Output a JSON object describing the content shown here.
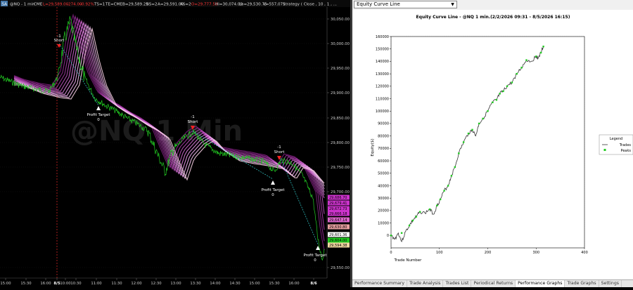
{
  "price_chart": {
    "header": {
      "badge": "SA",
      "symbol": "@NQ - 1 min",
      "exchange": "CME",
      "last": "L=29,589.00",
      "change": "-274.00",
      "change_pct": "-0.92%",
      "ts": "TS=1",
      "te": "TE=CME",
      "bid": "B=29,589.25",
      "bs": "BS=2",
      "ask": "A=29,591.00",
      "as": "AS=2",
      "open": "O=29,777.50",
      "high": "Hi=30,074.00",
      "low": "Lo=29,530.75",
      "volume": "V=557,071",
      "strategy": "Strategy ( Close , 10 , 1 , ..."
    },
    "watermark": "@NQ 1 Min",
    "y_ticks": [
      "30,050.00",
      "30,000.00",
      "29,950.00",
      "29,900.00",
      "29,850.00",
      "29,800.00",
      "29,750.00",
      "29,700.00",
      "29,550.00"
    ],
    "price_tags": [
      {
        "text": "29,686.70",
        "color": "#cc33cc"
      },
      {
        "text": "29,679.41",
        "color": "#cc33cc"
      },
      {
        "text": "29,672.73",
        "color": "#cc33cc"
      },
      {
        "text": "29,666.18",
        "color": "#cc33cc"
      },
      {
        "text": "29,647.14",
        "color": "#dd66cc"
      },
      {
        "text": "29,630.80",
        "color": "#e8a0a0"
      },
      {
        "text": "29,601.36",
        "color": "#ffffff"
      },
      {
        "text": "29,604.00",
        "color": "#22cc22"
      },
      {
        "text": "29,594.38",
        "color": "#f0d8a0"
      }
    ],
    "x_ticks": [
      "15:00",
      "15:30",
      "16:00",
      "8/5",
      "10:00",
      "10:30",
      "11:00",
      "11:30",
      "12:00",
      "12:30",
      "13:00",
      "13:30",
      "14:00",
      "14:30",
      "15:00",
      "15:30",
      "16:00",
      "8/6"
    ],
    "markers": [
      {
        "kind": "short",
        "label1": "-1",
        "label2": "Short"
      },
      {
        "kind": "short",
        "label1": "-1",
        "label2": "Short"
      },
      {
        "kind": "short",
        "label1": "-1",
        "label2": "Short"
      },
      {
        "kind": "cover",
        "label1": "Profit Target",
        "label2": "0"
      },
      {
        "kind": "cover",
        "label1": "Profit Target",
        "label2": "0"
      },
      {
        "kind": "cover",
        "label1": "Profit Target",
        "label2": "0"
      }
    ],
    "colors": {
      "price": "#22cc22",
      "ribbon_dark": "#8a2a8a",
      "ribbon_light": "#f0b0f0",
      "trade_line": "#33cccc",
      "session_line": "#cc2222"
    }
  },
  "perf_panel": {
    "dropdown": "Equity Curve Line",
    "tabs": [
      {
        "label": "Performance Summary",
        "active": false
      },
      {
        "label": "Trade Analysis",
        "active": false
      },
      {
        "label": "Trades List",
        "active": false
      },
      {
        "label": "Periodical Returns",
        "active": false
      },
      {
        "label": "Performance Graphs",
        "active": true
      },
      {
        "label": "Trade Graphs",
        "active": false
      },
      {
        "label": "Settings",
        "active": false
      }
    ],
    "legend": {
      "title": "Legend",
      "entries": [
        "Trades",
        "Peaks"
      ]
    }
  },
  "chart_data": {
    "type": "line",
    "title": "Equity Curve Line - @NQ 1 min.(2/2/2026 09:31 - 8/5/2026 16:15)",
    "xlabel": "Trade Number",
    "ylabel": "Equity($)",
    "xlim": [
      0,
      400
    ],
    "ylim": [
      -10000,
      160000
    ],
    "x_ticks": [
      "0",
      "100",
      "200",
      "300",
      "400"
    ],
    "y_ticks": [
      "0",
      "10000",
      "20000",
      "30000",
      "40000",
      "50000",
      "60000",
      "70000",
      "80000",
      "90000",
      "100000",
      "110000",
      "120000",
      "130000",
      "140000",
      "150000",
      "160000"
    ],
    "grid": true,
    "legend_position": "right",
    "series": [
      {
        "name": "Trades",
        "color": "#333333",
        "x": [
          0,
          8,
          15,
          22,
          30,
          38,
          45,
          52,
          60,
          70,
          80,
          88,
          95,
          102,
          110,
          118,
          125,
          132,
          140,
          150,
          160,
          168,
          175,
          182,
          190,
          200,
          210,
          218,
          225,
          232,
          240,
          250,
          260,
          270,
          280,
          290,
          300,
          305,
          310,
          315
        ],
        "values": [
          0,
          -3000,
          2000,
          -5000,
          3000,
          8000,
          12000,
          15000,
          19000,
          18000,
          21000,
          17000,
          24000,
          29000,
          36000,
          40000,
          48000,
          55000,
          66000,
          75000,
          82000,
          85000,
          80000,
          90000,
          94000,
          100000,
          107000,
          109000,
          114000,
          116000,
          120000,
          123000,
          130000,
          135000,
          141000,
          140000,
          144000,
          143000,
          147000,
          152000
        ]
      },
      {
        "name": "Peaks",
        "color": "#22cc22",
        "x": [
          0,
          22,
          38,
          45,
          52,
          60,
          80,
          95,
          102,
          110,
          118,
          125,
          132,
          140,
          150,
          160,
          168,
          182,
          190,
          200,
          210,
          218,
          225,
          232,
          240,
          250,
          260,
          270,
          280,
          300,
          310,
          315
        ],
        "values": [
          0,
          2000,
          8000,
          12000,
          15000,
          19000,
          21000,
          24000,
          29000,
          36000,
          40000,
          48000,
          55000,
          66000,
          75000,
          82000,
          85000,
          90000,
          94000,
          100000,
          107000,
          109000,
          114000,
          116000,
          120000,
          123000,
          130000,
          135000,
          141000,
          144000,
          147000,
          152000
        ]
      }
    ]
  }
}
